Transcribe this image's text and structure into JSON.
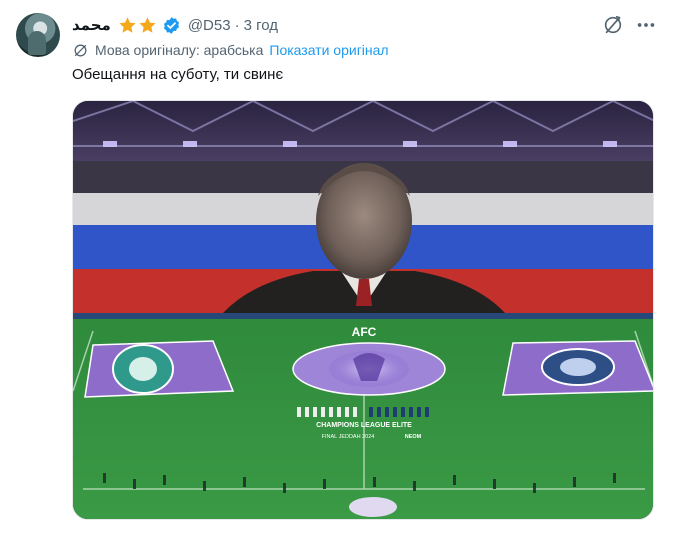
{
  "post": {
    "author_name": "محمد",
    "handle": "@D53",
    "separator": "·",
    "time": "3 год",
    "translation_label": "Мова оригіналу: арабська",
    "show_original_label": "Показати оригінал",
    "text": "Обещання на суботу, ти свинє"
  },
  "media": {
    "banner_brand": "AFC",
    "banner_title": "CHAMPIONS LEAGUE ELITE",
    "banner_sub": "FINAL JEDDAH 2024",
    "banner_sponsor": "NEOM"
  },
  "icons": {
    "star": "star-icon",
    "verified": "verified-badge-icon",
    "translate": "translate-icon",
    "more": "more-icon"
  },
  "colors": {
    "accent": "#1d9bf0",
    "star": "#f4a81c",
    "muted": "#536471"
  }
}
